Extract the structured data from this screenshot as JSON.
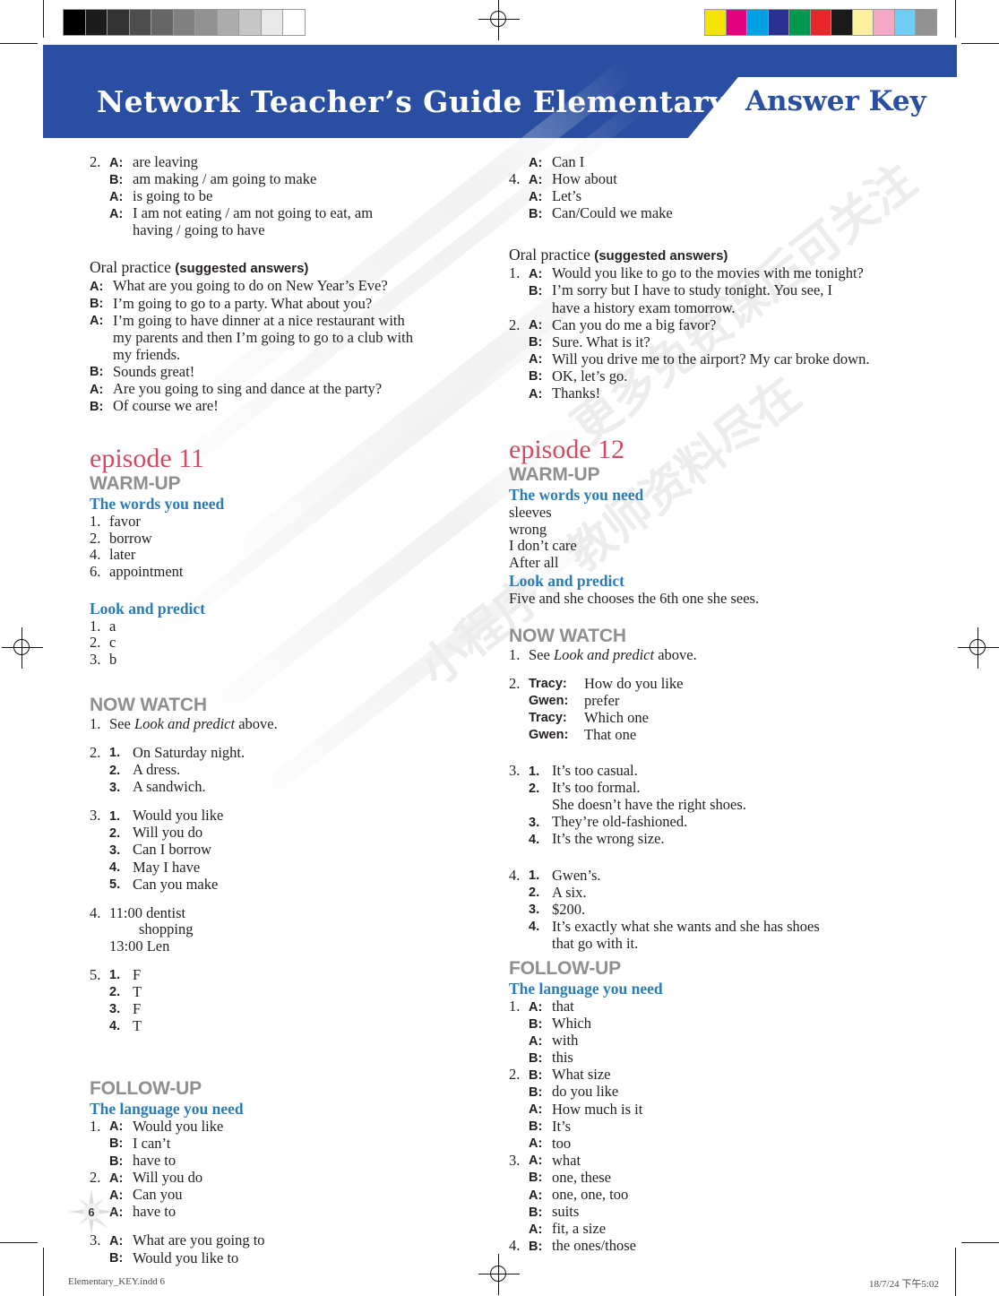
{
  "header": {
    "title": "Network Teacher’s Guide  Elementary",
    "badge": "Answer Key"
  },
  "calibration": {
    "grayscale": [
      "#000000",
      "#1c1c1c",
      "#333333",
      "#4d4d4d",
      "#666666",
      "#808080",
      "#919191",
      "#acacac",
      "#c6c6c6",
      "#e8e8e8",
      "#ffffff"
    ],
    "colors": [
      "#f5e400",
      "#e5007e",
      "#00a0e2",
      "#2b3192",
      "#009a4e",
      "#e8262c",
      "#1a1a1a",
      "#faf0a0",
      "#f5a8c5",
      "#72cdf4",
      "#929292"
    ]
  },
  "watermark": {
    "line1": "更多免费课后可关注",
    "line2": "小程序，教师资料尽在"
  },
  "left_column": {
    "item2": {
      "number": "2.",
      "lines": [
        {
          "speaker": "A:",
          "text": "are leaving"
        },
        {
          "speaker": "B:",
          "text": "am making / am going to make"
        },
        {
          "speaker": "A:",
          "text": "is going to be"
        },
        {
          "speaker": "A:",
          "text": "I am not eating / am not going to eat, am"
        },
        {
          "speaker": "",
          "text": "having / going to have"
        }
      ]
    },
    "oral_practice": {
      "heading_main": "Oral practice ",
      "heading_bold": "(suggested answers)",
      "lines": [
        {
          "speaker": "A:",
          "text": "What are you going to do on New Year’s Eve?"
        },
        {
          "speaker": "B:",
          "text": "I’m going to go to a party. What about you?"
        },
        {
          "speaker": "A:",
          "text": "I’m going to have dinner at a nice restaurant with"
        },
        {
          "speaker": "",
          "text": "my parents and then I’m going to go to a club with"
        },
        {
          "speaker": "",
          "text": "my friends."
        },
        {
          "speaker": "B:",
          "text": "Sounds great!"
        },
        {
          "speaker": "A:",
          "text": "Are you going to sing and dance at the party?"
        },
        {
          "speaker": "B:",
          "text": "Of course we are!"
        }
      ]
    },
    "episode": "episode 11",
    "warmup_label": "WARM-UP",
    "words_you_need": {
      "heading": "The words you need",
      "items": [
        {
          "number": "1.",
          "text": "favor"
        },
        {
          "number": "2.",
          "text": "borrow"
        },
        {
          "number": "4.",
          "text": "later"
        },
        {
          "number": "6.",
          "text": "appointment"
        }
      ]
    },
    "look_and_predict": {
      "heading": "Look and predict",
      "items": [
        {
          "number": "1.",
          "text": "a"
        },
        {
          "number": "2.",
          "text": "c"
        },
        {
          "number": "3.",
          "text": "b"
        }
      ]
    },
    "now_watch_label": "NOW WATCH",
    "now_watch": {
      "q1": {
        "number": "1.",
        "pre": "See ",
        "italic": "Look and predict",
        "post": " above."
      },
      "q2": {
        "number": "2.",
        "items": [
          {
            "sub": "1.",
            "text": "On Saturday night."
          },
          {
            "sub": "2.",
            "text": "A dress."
          },
          {
            "sub": "3.",
            "text": "A sandwich."
          }
        ]
      },
      "q3": {
        "number": "3.",
        "items": [
          {
            "sub": "1.",
            "text": "Would you like"
          },
          {
            "sub": "2.",
            "text": "Will you do"
          },
          {
            "sub": "3.",
            "text": "Can I borrow"
          },
          {
            "sub": "4.",
            "text": "May I have"
          },
          {
            "sub": "5.",
            "text": "Can you make"
          }
        ]
      },
      "q4": {
        "number": "4.",
        "lines": [
          "11:00 dentist",
          "        shopping",
          "13:00 Len"
        ]
      },
      "q5": {
        "number": "5.",
        "items": [
          {
            "sub": "1.",
            "text": "F"
          },
          {
            "sub": "2.",
            "text": "T"
          },
          {
            "sub": "3.",
            "text": "F"
          },
          {
            "sub": "4.",
            "text": "T"
          }
        ]
      }
    },
    "followup_label": "FOLLOW-UP",
    "language_you_need": {
      "heading": "The language you need",
      "groups": [
        {
          "number": "1.",
          "lines": [
            {
              "speaker": "A:",
              "text": "Would you like"
            },
            {
              "speaker": "B:",
              "text": "I can’t"
            },
            {
              "speaker": "B:",
              "text": "have to"
            }
          ]
        },
        {
          "number": "2.",
          "lines": [
            {
              "speaker": "A:",
              "text": "Will you do"
            },
            {
              "speaker": "A:",
              "text": "Can you"
            },
            {
              "speaker": "A:",
              "text": "have to"
            }
          ]
        },
        {
          "number": "3.",
          "lines": [
            {
              "speaker": "A:",
              "text": "What are you going to"
            },
            {
              "speaker": "B:",
              "text": "Would you like to"
            }
          ]
        }
      ]
    }
  },
  "right_column": {
    "continued": {
      "lines": [
        {
          "number": "",
          "speaker": "A:",
          "text": "Can I"
        },
        {
          "number": "4.",
          "speaker": "A:",
          "text": "How about"
        },
        {
          "number": "",
          "speaker": "A:",
          "text": "Let’s"
        },
        {
          "number": "",
          "speaker": "B:",
          "text": "Can/Could we make"
        }
      ]
    },
    "oral_practice": {
      "heading_main": "Oral practice ",
      "heading_bold": "(suggested answers)",
      "groups": [
        {
          "number": "1.",
          "lines": [
            {
              "speaker": "A:",
              "text": "Would you like to go to the movies with me tonight?"
            },
            {
              "speaker": "B:",
              "text": "I’m sorry but I have to study tonight. You see, I"
            },
            {
              "speaker": "",
              "text": "have a history exam tomorrow."
            }
          ]
        },
        {
          "number": "2.",
          "lines": [
            {
              "speaker": "A:",
              "text": "Can you do me a big favor?"
            },
            {
              "speaker": "B:",
              "text": "Sure.  What is it?"
            },
            {
              "speaker": "A:",
              "text": "Will you drive me to the airport? My car broke down."
            },
            {
              "speaker": "B:",
              "text": "OK, let’s go."
            },
            {
              "speaker": "A:",
              "text": "Thanks!"
            }
          ]
        }
      ]
    },
    "episode": "episode 12",
    "warmup_label": "WARM-UP",
    "words_you_need": {
      "heading": "The words you need",
      "items": [
        "sleeves",
        "wrong",
        "I don’t care",
        "After all"
      ]
    },
    "look_and_predict": {
      "heading": "Look and predict",
      "text": "Five and she chooses the 6th one she sees."
    },
    "now_watch_label": "NOW WATCH",
    "now_watch": {
      "q1": {
        "number": "1.",
        "pre": "See ",
        "italic": "Look and predict",
        "post": " above."
      },
      "q2": {
        "number": "2.",
        "lines": [
          {
            "speaker": "Tracy:",
            "text": "How do you like"
          },
          {
            "speaker": "Gwen:",
            "text": "prefer"
          },
          {
            "speaker": "Tracy:",
            "text": "Which one"
          },
          {
            "speaker": "Gwen:",
            "text": "That one"
          }
        ]
      },
      "q3": {
        "number": "3.",
        "items": [
          {
            "sub": "1.",
            "text": "It’s too casual."
          },
          {
            "sub": "2.",
            "text": "It’s too formal."
          },
          {
            "sub": "",
            "text": "She doesn’t have the right shoes."
          },
          {
            "sub": "3.",
            "text": "They’re old-fashioned."
          },
          {
            "sub": "4.",
            "text": "It’s the wrong size."
          }
        ]
      },
      "q4": {
        "number": "4.",
        "items": [
          {
            "sub": "1.",
            "text": "Gwen’s."
          },
          {
            "sub": "2.",
            "text": "A six."
          },
          {
            "sub": "3.",
            "text": "$200."
          },
          {
            "sub": "4.",
            "text": "It’s exactly what she wants and she has shoes"
          },
          {
            "sub": "",
            "text": "that go with it."
          }
        ]
      }
    },
    "followup_label": "FOLLOW-UP",
    "language_you_need": {
      "heading": "The language you need",
      "groups": [
        {
          "number": "1.",
          "lines": [
            {
              "speaker": "A:",
              "text": "that"
            },
            {
              "speaker": "B:",
              "text": "Which"
            },
            {
              "speaker": "A:",
              "text": "with"
            },
            {
              "speaker": "B:",
              "text": "this"
            }
          ]
        },
        {
          "number": "2.",
          "lines": [
            {
              "speaker": "B:",
              "text": "What size"
            },
            {
              "speaker": "B:",
              "text": "do you like"
            },
            {
              "speaker": "A:",
              "text": "How much is it"
            },
            {
              "speaker": "B:",
              "text": "It’s"
            },
            {
              "speaker": "A:",
              "text": "too"
            }
          ]
        },
        {
          "number": "3.",
          "lines": [
            {
              "speaker": "A:",
              "text": "what"
            },
            {
              "speaker": "B:",
              "text": "one, these"
            },
            {
              "speaker": "A:",
              "text": "one, one, too"
            },
            {
              "speaker": "B:",
              "text": "suits"
            },
            {
              "speaker": "A:",
              "text": "fit, a size"
            }
          ]
        },
        {
          "number": "4.",
          "lines": [
            {
              "speaker": "B:",
              "text": "the ones/those"
            }
          ]
        }
      ]
    }
  },
  "page_number": "6",
  "footer": {
    "left": "Elementary_KEY.indd   6",
    "right": "18/7/24   下午5:02"
  },
  "colors": {
    "header_blue": "#2a4fa2",
    "episode_red": "#cf4b63",
    "subheading_blue": "#2b7cb5",
    "section_gray": "#8f8f8f",
    "body_text": "#231f20"
  }
}
